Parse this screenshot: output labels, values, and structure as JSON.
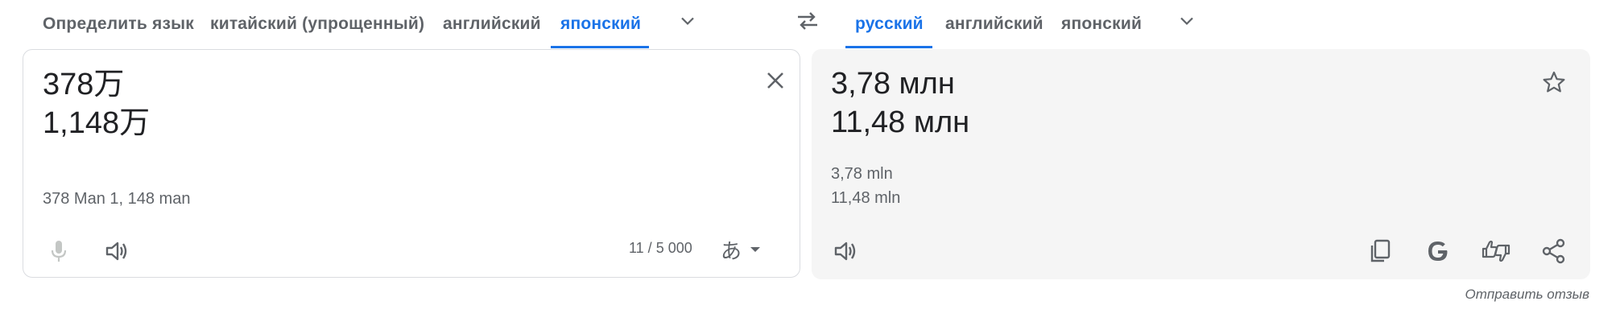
{
  "source_langs": {
    "detect": "Определить язык",
    "chinese": "китайский (упрощенный)",
    "english": "английский",
    "japanese": "японский"
  },
  "target_langs": {
    "russian": "русский",
    "english": "английский",
    "japanese": "японский"
  },
  "source": {
    "line1": "378万",
    "line2": "1,148万",
    "transliteration": "378 Man 1, 148 man",
    "char_count": "11 / 5 000",
    "ime_char": "あ"
  },
  "target": {
    "line1": "3,78 млн",
    "line2": "11,48 млн",
    "translit1": "3,78 mln",
    "translit2": "11,48 mln"
  },
  "feedback_label": "Отправить отзыв",
  "colors": {
    "accent": "#1a73e8",
    "icon": "#5f6368",
    "panel_bg": "#f5f5f5"
  },
  "icons": [
    "chevron-down-icon",
    "swap-icon",
    "close-icon",
    "star-icon",
    "microphone-icon",
    "speaker-icon",
    "copy-icon",
    "google-icon",
    "rate-icon",
    "share-icon"
  ]
}
